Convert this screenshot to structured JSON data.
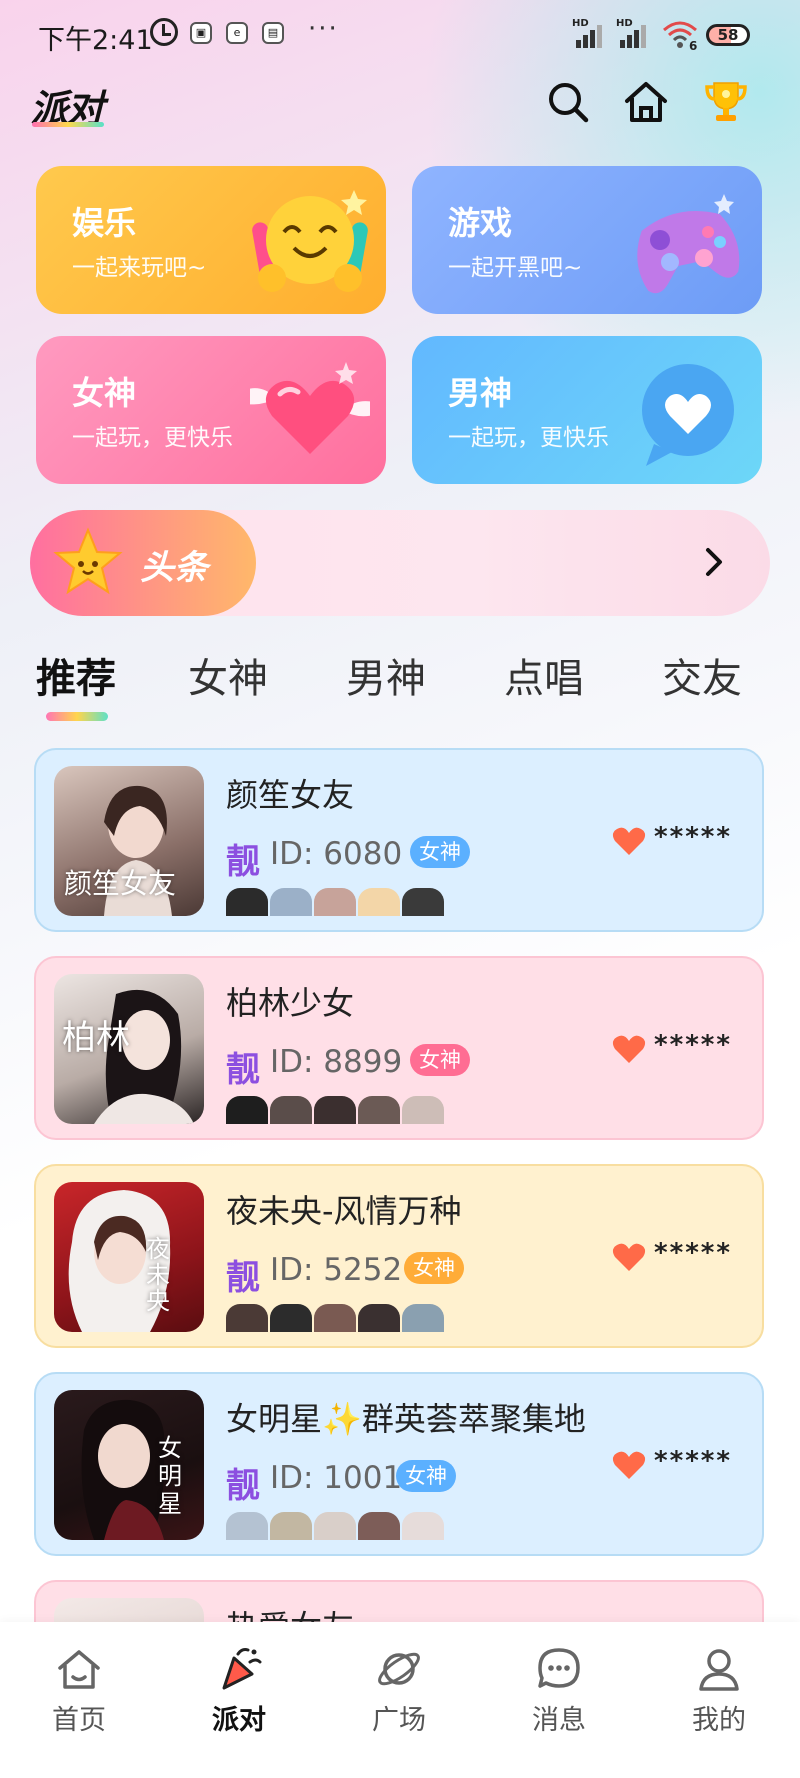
{
  "status_bar": {
    "time": "下午2:41",
    "dots": "···",
    "signal1_label": "HD",
    "signal2_label": "HD",
    "wifi_extra": "6",
    "battery": "58"
  },
  "header": {
    "logo": "派对"
  },
  "categories": [
    {
      "title": "娱乐",
      "subtitle": "一起来玩吧~"
    },
    {
      "title": "游戏",
      "subtitle": "一起开黑吧~"
    },
    {
      "title": "女神",
      "subtitle": "一起玩，更快乐"
    },
    {
      "title": "男神",
      "subtitle": "一起玩，更快乐"
    }
  ],
  "headline": {
    "label": "头条"
  },
  "tabs": [
    {
      "label": "推荐"
    },
    {
      "label": "女神"
    },
    {
      "label": "男神"
    },
    {
      "label": "点唱"
    },
    {
      "label": "交友"
    }
  ],
  "rooms": [
    {
      "name": "颜笙女友",
      "liang": "靓",
      "id_text": "ID: 6080",
      "badge": "女神",
      "hot": "*****",
      "cover_text": "颜笙女友"
    },
    {
      "name": "柏林少女",
      "liang": "靓",
      "id_text": "ID: 8899",
      "badge": "女神",
      "hot": "*****",
      "cover_text": "柏林"
    },
    {
      "name": "夜未央-风情万种",
      "liang": "靓",
      "id_text": "ID: 5252",
      "badge": "女神",
      "hot": "*****",
      "cover_text": "夜未央"
    },
    {
      "name": "女明星✨群英荟萃聚集地",
      "liang": "靓",
      "id_text": "ID: 1001",
      "badge": "女神",
      "hot": "*****",
      "cover_text": "女明星"
    },
    {
      "name": "热爱女友"
    }
  ],
  "bottom_nav": [
    {
      "label": "首页",
      "icon": "home-icon"
    },
    {
      "label": "派对",
      "icon": "party-icon"
    },
    {
      "label": "广场",
      "icon": "planet-icon"
    },
    {
      "label": "消息",
      "icon": "message-icon"
    },
    {
      "label": "我的",
      "icon": "profile-icon"
    }
  ],
  "colors": {
    "accent_purple": "#8c4fe0",
    "badge_blue": "#5bb0ff",
    "badge_pink": "#ff6d93",
    "badge_orange": "#ffac38"
  }
}
